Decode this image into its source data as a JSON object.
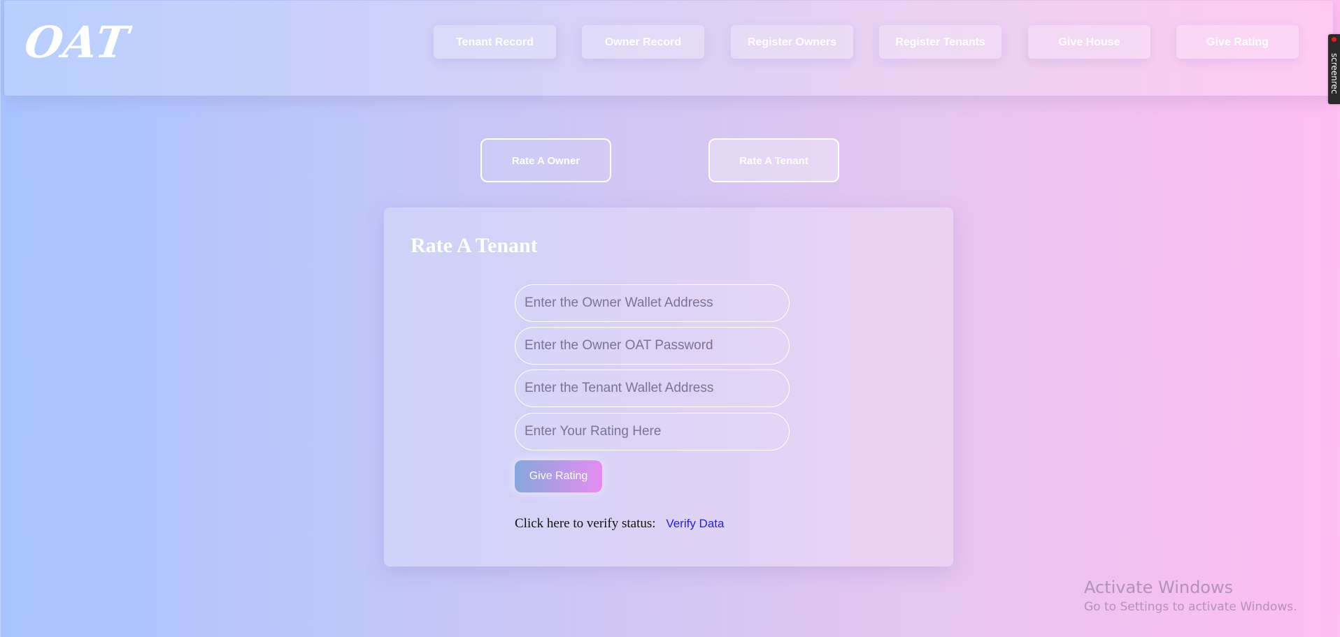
{
  "header": {
    "logo": "OAT",
    "nav": [
      {
        "label": "Tenant Record"
      },
      {
        "label": "Owner Record"
      },
      {
        "label": "Register Owners"
      },
      {
        "label": "Register Tenants"
      },
      {
        "label": "Give House"
      },
      {
        "label": "Give Rating"
      }
    ]
  },
  "tabs": [
    {
      "label": "Rate A Owner",
      "active": false
    },
    {
      "label": "Rate A Tenant",
      "active": true
    }
  ],
  "form": {
    "title": "Rate A Tenant",
    "fields": [
      {
        "placeholder": "Enter the Owner Wallet Address",
        "value": ""
      },
      {
        "placeholder": "Enter the Owner OAT Password",
        "value": ""
      },
      {
        "placeholder": "Enter the Tenant Wallet Address",
        "value": ""
      },
      {
        "placeholder": "Enter Your Rating Here",
        "value": ""
      }
    ],
    "submit_label": "Give Rating",
    "verify_text": "Click here to verify status:",
    "verify_link": "Verify Data"
  },
  "overlay": {
    "screenrec_label": "screenrec",
    "watermark_title": "Activate Windows",
    "watermark_sub": "Go to Settings to activate Windows."
  },
  "colors": {
    "accent_link": "#2222dd",
    "button_gradient_start": "#86a7dd",
    "button_gradient_end": "#e58cf0",
    "recording_dot": "#e02020"
  },
  "icons": {
    "recording": "record-dot-icon"
  }
}
